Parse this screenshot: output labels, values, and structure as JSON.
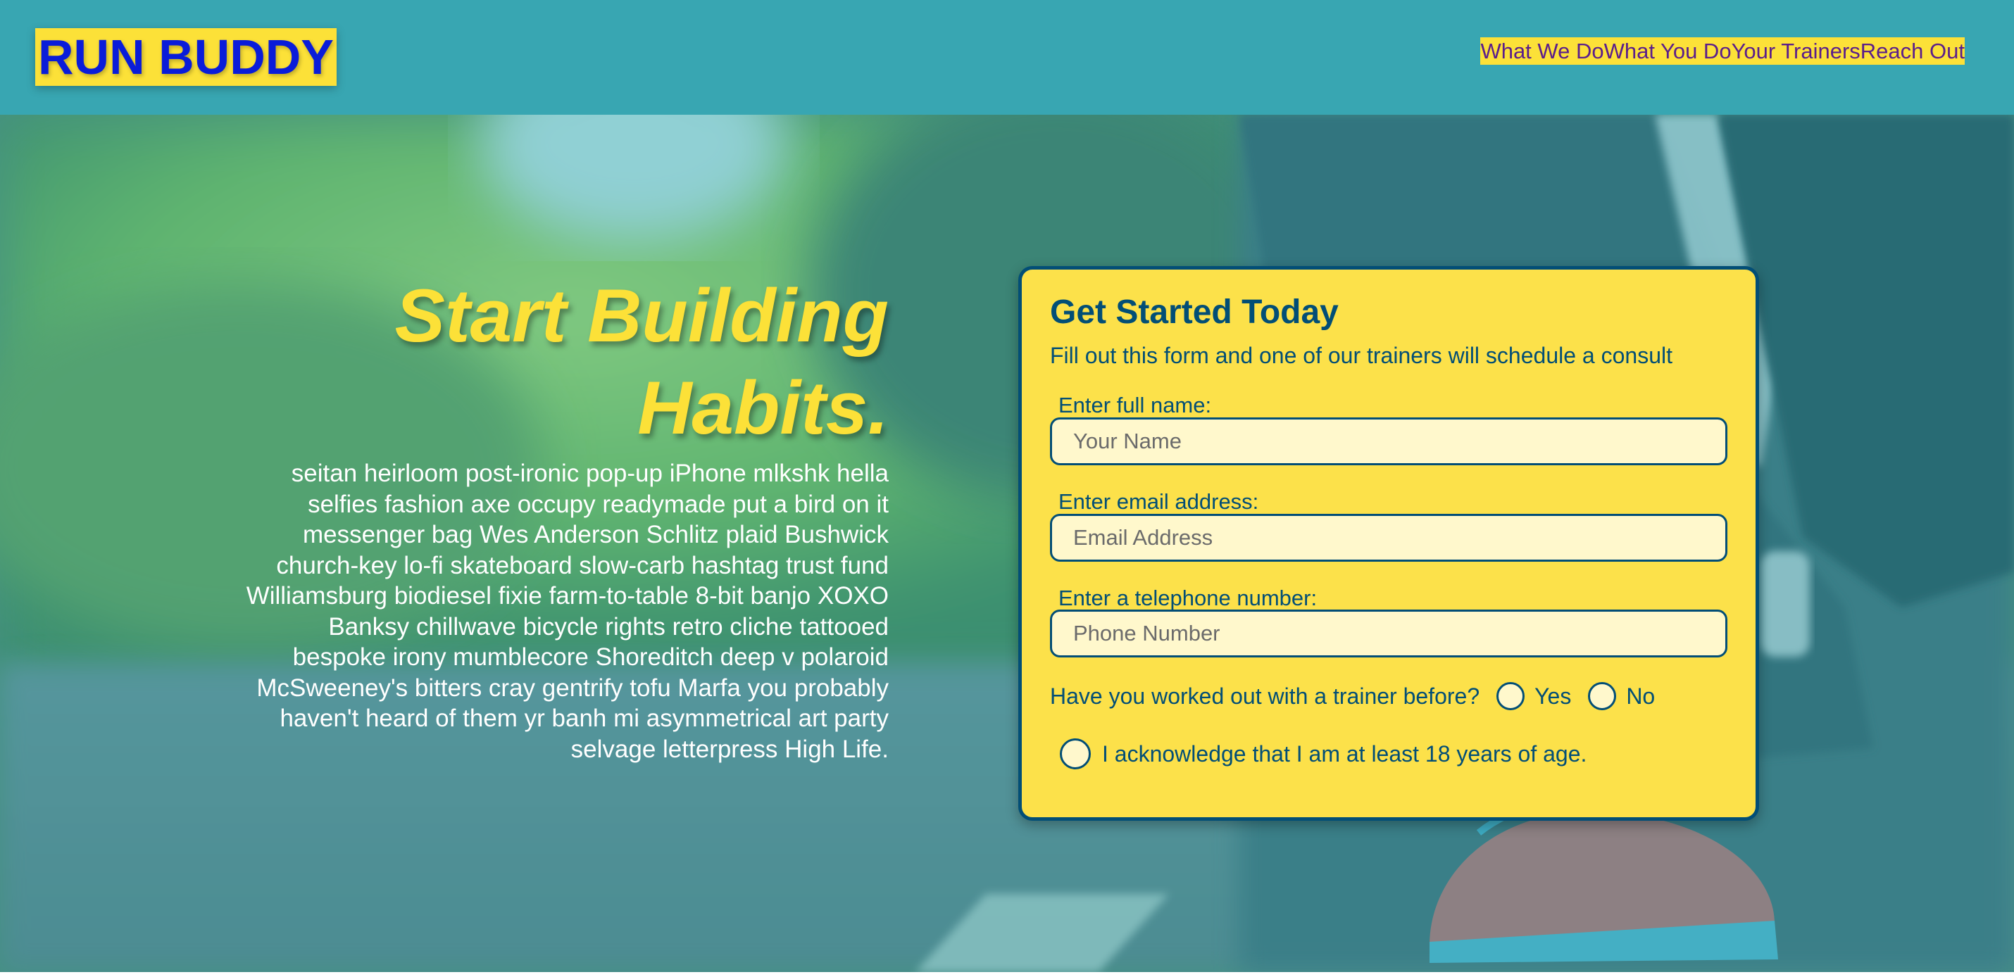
{
  "header": {
    "logo": "RUN BUDDY",
    "nav": [
      "What We Do",
      "What You Do",
      "Your Trainers",
      "Reach Out"
    ]
  },
  "hero": {
    "title_line1": "Start Building",
    "title_line2": "Habits.",
    "body": "seitan heirloom post-ironic pop-up iPhone mlkshk hella selfies fashion axe occupy readymade put a bird on it messenger bag Wes Anderson Schlitz plaid Bushwick church-key lo-fi skateboard slow-carb hashtag trust fund Williamsburg biodiesel fixie farm-to-table 8-bit banjo XOXO Banksy chillwave bicycle rights retro cliche tattooed bespoke irony mumblecore Shoreditch deep v polaroid McSweeney's bitters cray gentrify tofu Marfa you probably haven't heard of them yr banh mi asymmetrical art party selvage letterpress High Life."
  },
  "form": {
    "title": "Get Started Today",
    "subtitle": "Fill out this form and one of our trainers will schedule a consult",
    "name_label": "Enter full name:",
    "name_placeholder": "Your Name",
    "email_label": "Enter email address:",
    "email_placeholder": "Email Address",
    "phone_label": "Enter a telephone number:",
    "phone_placeholder": "Phone Number",
    "trainer_question": "Have you worked out with a trainer before?",
    "yes_label": "Yes",
    "no_label": "No",
    "acknowledge_label": "I acknowledge that I am at least 18 years of age."
  },
  "colors": {
    "header_bg": "#38a6b2",
    "accent_yellow": "#fce138",
    "logo_text": "#0a1cd9",
    "nav_text": "#5a1d8c",
    "form_text": "#024e76"
  },
  "icons": [
    "radio-circle-icon"
  ]
}
